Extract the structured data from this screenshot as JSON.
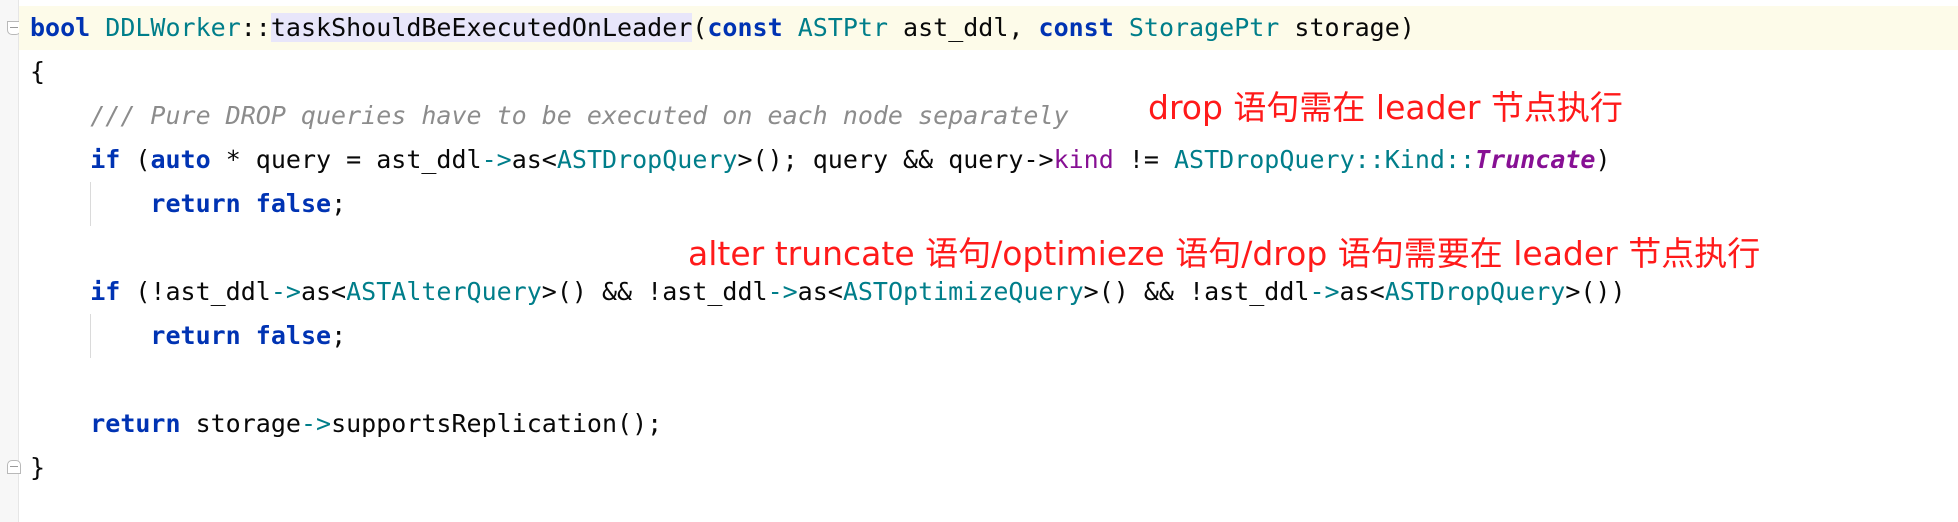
{
  "code": {
    "l1": {
      "bool": "bool",
      "cls": "DDLWorker",
      "sep": "::",
      "fn": "taskShouldBeExecutedOnLeader",
      "open": "(",
      "const1": "const",
      "t1": "ASTPtr",
      "p1": " ast_ddl, ",
      "const2": "const",
      "t2": "StoragePtr",
      "p2": " storage)"
    },
    "l2": "{",
    "l3_comment": "/// Pure DROP queries have to be executed on each node separately",
    "l4": {
      "if": "if",
      "paren": " (",
      "auto": "auto",
      "a": " * query = ast_ddl",
      "arrow1": "->",
      "as1": "as<",
      "t": "ASTDropQuery",
      "b": ">(); query && query->",
      "kind": "kind",
      "c": " != ",
      "t2": "ASTDropQuery",
      "s1": "::",
      "kindt": "Kind",
      "s2": "::",
      "trunc": "Truncate",
      "close": ")"
    },
    "l5": {
      "ret": "return",
      "sp": " ",
      "false": "false",
      "semi": ";"
    },
    "l7": {
      "if": "if",
      "a": " (!ast_ddl",
      "arrow1": "->",
      "as1": "as<",
      "t1": "ASTAlterQuery",
      "b": ">() && !ast_ddl",
      "arrow2": "->",
      "as2": "as<",
      "t2": "ASTOptimizeQuery",
      "c": ">() && !ast_ddl",
      "arrow3": "->",
      "as3": "as<",
      "t3": "ASTDropQuery",
      "d": ">())"
    },
    "l8": {
      "ret": "return",
      "sp": " ",
      "false": "false",
      "semi": ";"
    },
    "l10": {
      "ret": "return",
      "a": " storage",
      "arrow": "->",
      "b": "supportsReplication();"
    },
    "l11": "}"
  },
  "annotations": {
    "a1": "drop 语句需在 leader 节点执行",
    "a2": "alter truncate 语句/optimieze 语句/drop 语句需要在 leader 节点执行"
  },
  "colors": {
    "keyword": "#0033b3",
    "type": "#007e8a",
    "comment": "#8c8c8c",
    "member": "#871094",
    "annotation": "#ff1a1a",
    "line_highlight": "#fdfbe9",
    "function_highlight": "#e8e6fa"
  },
  "icons": [
    "fold-collapse-icon",
    "fold-end-icon"
  ]
}
